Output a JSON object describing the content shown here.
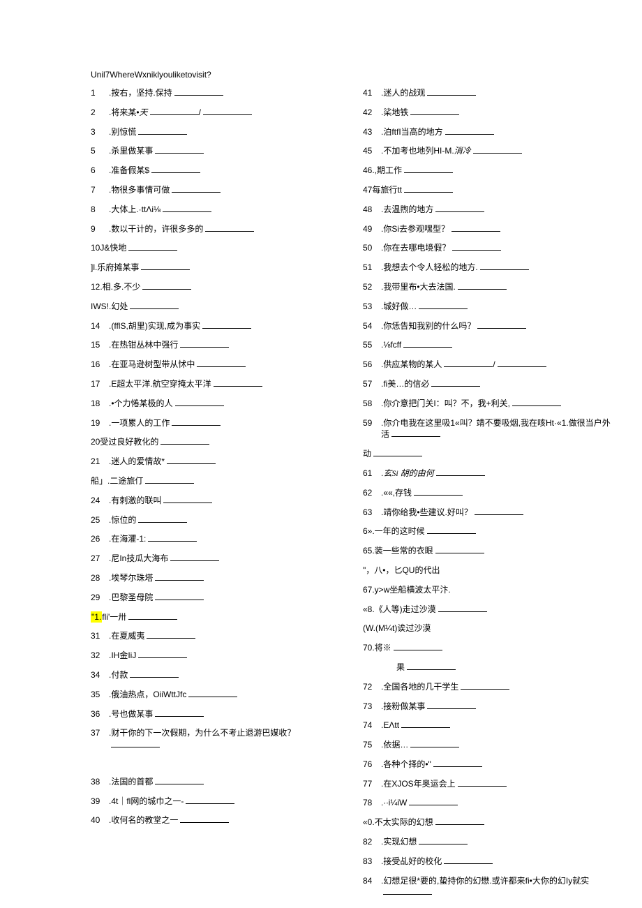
{
  "title": "Unil7WhereWxniklyouliketovisit?",
  "left": [
    {
      "n": "1",
      "t": ".按右，坚持.保持"
    },
    {
      "n": "2",
      "t": ".将来某•",
      "it": "天",
      "slash": true
    },
    {
      "n": "3",
      "t": ".别惊慌"
    },
    {
      "n": "5",
      "t": ".杀里做某事"
    },
    {
      "n": "6",
      "t": ".准备假某$"
    },
    {
      "n": "7",
      "t": ".物很多事情可做"
    },
    {
      "n": "8",
      "t": ".大体上.·ttΛi⅛"
    },
    {
      "n": "9",
      "t": ".数以干计的，许很多多的"
    },
    {
      "n": "",
      "t": "10J&快地",
      "nonum": true
    },
    {
      "n": "",
      "t": "]l.乐府摊某事",
      "nonum": true
    },
    {
      "n": "",
      "t": "12.相.多.不少",
      "nonum": true
    },
    {
      "n": "",
      "t": "IWS!.幻处",
      "nonum": true
    },
    {
      "n": "14",
      "t": ".(fflS,胡里)实现,成为事实"
    },
    {
      "n": "15",
      "t": ".在热钳丛林中强行"
    },
    {
      "n": "16",
      "t": ".在亚马逊树型带从怵中"
    },
    {
      "n": "17",
      "t": ".E超太平洋.航空穿掩太平洋"
    },
    {
      "n": "18",
      "t": ".•个力惓某极的人"
    },
    {
      "n": "19",
      "t": ".一项累人的工作"
    },
    {
      "n": "",
      "t": "20受过良好教化的",
      "nonum": true
    },
    {
      "n": "21",
      "t": ".迷人的爱情故*"
    },
    {
      "n": "",
      "t": "船」.二途旅仃",
      "nonum": true
    },
    {
      "n": "24",
      "t": ".有刺激的联叫"
    },
    {
      "n": "25",
      "t": ".惊位的"
    },
    {
      "n": "26",
      "t": ".在海灈-1:"
    },
    {
      "n": "27",
      "t": ".尼In技瓜大海布"
    },
    {
      "n": "28",
      "t": ".埃琴尔珠塔"
    },
    {
      "n": "29",
      "t": ".巴黎圣母院"
    },
    {
      "n": "",
      "t": "",
      "hl": "\"1.",
      "after_hl": "fli'一卅",
      "nonum": true
    },
    {
      "n": "31",
      "t": ".在夏威夷"
    },
    {
      "n": "32",
      "t": ".IH金IiJ"
    },
    {
      "n": "34",
      "t": ".付款"
    },
    {
      "n": "35",
      "t": ".俄油热点，OiiWttJfc"
    },
    {
      "n": "36",
      "t": ".号也做某事"
    },
    {
      "n": "37",
      "t": ".财干你的下一次假期，为什么不考止退游巴媒收？"
    },
    {
      "n": "",
      "t": "",
      "nonum": true,
      "spacer": true
    },
    {
      "n": "38",
      "t": ".法国的首都"
    },
    {
      "n": "39",
      "t": ".4t｜fl网的城巾之一-"
    },
    {
      "n": "40",
      "t": ".收何名的教堂之一"
    }
  ],
  "right": [
    {
      "n": "41",
      "t": ".迷人的战观"
    },
    {
      "n": "42",
      "t": ".桬地铁"
    },
    {
      "n": "43",
      "t": ".泊ftfI当高的地方"
    },
    {
      "n": "45",
      "t": ".不加考也地列HI-M.",
      "it": "消冷"
    },
    {
      "n": "",
      "t": "46.,期工作",
      "nonum": true
    },
    {
      "n": "",
      "t": "47每旅行tt",
      "nonum": true
    },
    {
      "n": "48",
      "t": ".去温煦的地方"
    },
    {
      "n": "49",
      "t": ".你Si去参观嘿型？"
    },
    {
      "n": "50",
      "t": ".你在去哪电境假？"
    },
    {
      "n": "51",
      "t": ".我想去个令人轻松的地方."
    },
    {
      "n": "52",
      "t": ".我带里布•大去法国."
    },
    {
      "n": "53",
      "t": ".城好做…"
    },
    {
      "n": "54",
      "t": ".你恁告知我别的什么吗？"
    },
    {
      "n": "55",
      "t": ".⅛fcff"
    },
    {
      "n": "56",
      "t": ".供应某物的某人",
      "slash": true
    },
    {
      "n": "57",
      "t": ".fi美…的信必"
    },
    {
      "n": "58",
      "t": ".你介意把门关I：叫？不，我+利关,"
    },
    {
      "n": "59",
      "t": ".你介电我在这里吸1«叫？靖不要吸烟,我在咳Ht·«1.做很当户外活"
    },
    {
      "n": "",
      "t": "动",
      "nonum": true
    },
    {
      "n": "61",
      "t": ".",
      "it2": "玄Si 胡的由何"
    },
    {
      "n": "62",
      "t": ".««,存钱"
    },
    {
      "n": "63",
      "t": ".靖你给我•些建议.好叫？"
    },
    {
      "n": "",
      "t": "6».一年的这时候",
      "nonum": true
    },
    {
      "n": "",
      "t": "65.装一些常的衣眼",
      "nonum": true
    },
    {
      "n": "",
      "t": "\"，八•，匕QU的代出",
      "nonum": true,
      "no_blank": true
    },
    {
      "n": "",
      "t": "67.y>w坐船横波太平汴.",
      "nonum": true,
      "no_blank": true
    },
    {
      "n": "",
      "t": "«8.《人等)走过沙漠",
      "nonum": true
    },
    {
      "n": "",
      "t": "(W.(M¼t)诶过沙漠",
      "nonum": true,
      "no_blank": true
    },
    {
      "n": "",
      "t": "70.将※",
      "nonum": true
    },
    {
      "n": "",
      "t": "　　　　果",
      "nonum": true
    },
    {
      "n": "72",
      "t": ".全国各地的几干学生"
    },
    {
      "n": "73",
      "t": ".接粉做某事"
    },
    {
      "n": "74",
      "t": ".EΛtt"
    },
    {
      "n": "75",
      "t": ".依据…"
    },
    {
      "n": "76",
      "t": ".各种个择的•\""
    },
    {
      "n": "77",
      "t": ".在XJOS年奥运会上"
    },
    {
      "n": "78",
      "t": ".·∙i¼iW"
    },
    {
      "n": "",
      "t": "«0.不太实际的幻想",
      "nonum": true
    },
    {
      "n": "82",
      "t": ".实现幻想"
    },
    {
      "n": "83",
      "t": ".接受乩好的校化"
    },
    {
      "n": "84",
      "t": ".幻想足很*要的,蛰持你的幻懋.或许都来fi•大你的幻Iy就实"
    }
  ]
}
